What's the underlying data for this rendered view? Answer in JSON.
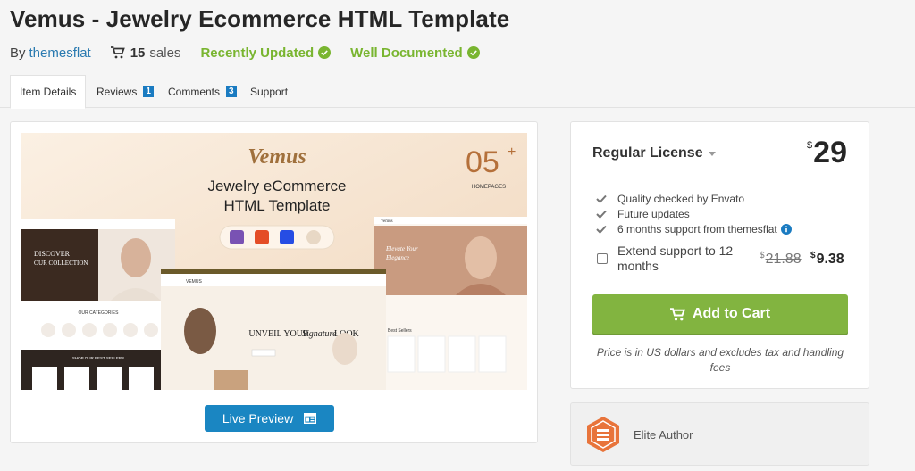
{
  "header": {
    "title": "Vemus - Jewelry Ecommerce HTML Template",
    "by": "By",
    "author": "themesflat",
    "sales_count": "15",
    "sales_word": "sales",
    "badge_updated": "Recently Updated",
    "badge_documented": "Well Documented"
  },
  "tabs": [
    {
      "label": "Item Details",
      "active": true
    },
    {
      "label": "Reviews",
      "count": "1"
    },
    {
      "label": "Comments",
      "count": "3"
    },
    {
      "label": "Support"
    }
  ],
  "preview": {
    "brand": "Vemus",
    "headline_1": "Jewelry eCommerce",
    "headline_2": "HTML Template",
    "count": "05",
    "count_plus": "+",
    "count_label": "HOMEPAGES",
    "hero_left_1": "DISCOVER",
    "hero_left_2": "OUR COLLECTION",
    "categories_label": "OUR CATEGORIES",
    "shop_label": "SHOP OUR BEST SELLERS",
    "center_logo": "VEMUS",
    "center_headline_1": "UNVEIL YOUR",
    "center_headline_2": "Signature",
    "center_headline_3": "LOOK",
    "right_logo": "Vemus",
    "right_hero_1": "Elevate Your",
    "right_hero_2": "Elegance",
    "right_section": "Best Sellers",
    "live_preview_label": "Live Preview"
  },
  "license": {
    "name": "Regular License",
    "currency": "$",
    "price": "29",
    "features": [
      "Quality checked by Envato",
      "Future updates",
      "6 months support from themesflat"
    ],
    "extend_label": "Extend support to 12 months",
    "old_price": "21.88",
    "new_price": "9.38",
    "add_to_cart": "Add to Cart",
    "note": "Price is in US dollars and excludes tax and handling fees"
  },
  "author_box": {
    "label": "Elite Author"
  },
  "colors": {
    "green": "#82b440",
    "blue": "#1a86c2",
    "badge_green": "#79b530",
    "elite_orange": "#e8743b"
  }
}
